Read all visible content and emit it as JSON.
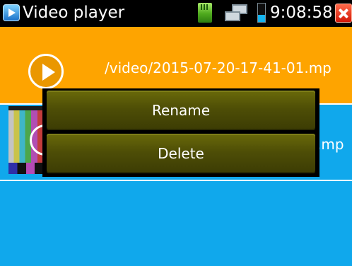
{
  "titlebar": {
    "app_icon": "video-player-icon",
    "title": "Video player",
    "status_icons": [
      "sd-card-icon",
      "network-icon",
      "battery-icon"
    ],
    "time": "9:08:58",
    "close_icon": "close-icon"
  },
  "files": [
    {
      "name": "/video/2015-07-20-17-41-01.mp",
      "icon": "play-icon",
      "selected": true
    },
    {
      "name": ".mp",
      "icon": "video-thumbnail",
      "selected": false
    }
  ],
  "context_menu": {
    "rename_label": "Rename",
    "delete_label": "Delete"
  },
  "colors": {
    "background": "#10a8ec",
    "selected_row": "#fea400",
    "titlebar": "#000000",
    "menu_button": "#4e4e06"
  }
}
